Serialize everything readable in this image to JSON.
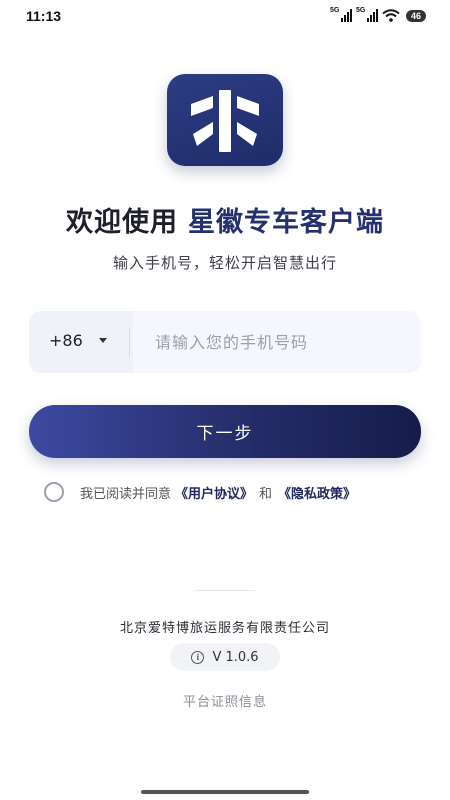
{
  "status_bar": {
    "time": "11:13",
    "signal_1_label": "5G",
    "signal_2_label": "5G",
    "battery": "46"
  },
  "app": {
    "title_prefix": "欢迎使用",
    "title_brand": "星徽专车客户端",
    "subtitle": "输入手机号，轻松开启智慧出行"
  },
  "login_form": {
    "country_code": "+86",
    "phone_placeholder": "请输入您的手机号码",
    "phone_value": "",
    "next_button": "下一步"
  },
  "agreement": {
    "prefix": "我已阅读并同意",
    "user_agreement": "《用户协议》",
    "and": "和",
    "privacy_policy": "《隐私政策》",
    "checked": false
  },
  "footer": {
    "company": "北京爱特博旅运服务有限责任公司",
    "version": "V 1.0.6",
    "platform_info": "平台证照信息"
  },
  "colors": {
    "brand_dark": "#1f2c69",
    "button_start": "#3d4aa1",
    "button_end": "#161c4a",
    "input_bg": "#eff2f9"
  },
  "icons": {
    "logo": "app-logo-icon",
    "dropdown": "caret-down-icon",
    "checkbox": "circle-checkbox-icon",
    "info": "info-icon"
  }
}
